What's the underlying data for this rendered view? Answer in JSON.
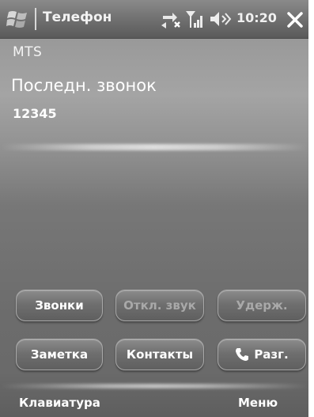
{
  "titlebar": {
    "title": "Телефон",
    "time": "10:20"
  },
  "call_info": {
    "operator": "MTS",
    "status": "Последн. звонок",
    "number": "12345"
  },
  "buttons": {
    "calls": "Звонки",
    "mute": "Откл. звук",
    "hold": "Удерж.",
    "note": "Заметка",
    "contacts": "Контакты",
    "talk": "Разг."
  },
  "softkeys": {
    "left": "Клавиатура",
    "right": "Меню"
  },
  "icons": [
    "windows-start-icon",
    "sync-icon",
    "signal-icon",
    "volume-icon",
    "close-icon",
    "phone-icon"
  ],
  "colors": {
    "background": "#6c6c6c",
    "text": "#ffffff",
    "disabled_text": "#a9a9a9"
  }
}
